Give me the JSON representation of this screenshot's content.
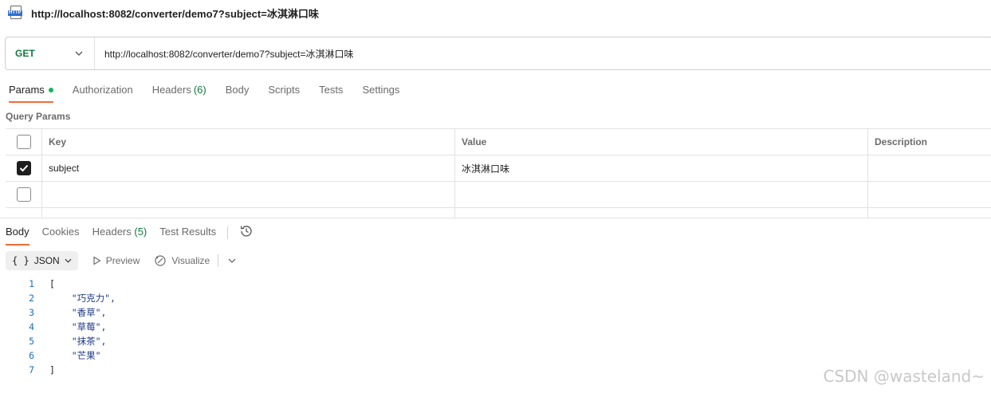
{
  "window": {
    "icon": "http-file-icon",
    "icon_label": "HTTP",
    "title": "http://localhost:8082/converter/demo7?subject=冰淇淋口味"
  },
  "request": {
    "method": "GET",
    "url": "http://localhost:8082/converter/demo7?subject=冰淇淋口味"
  },
  "request_tabs": [
    {
      "label": "Params",
      "active": true,
      "dot": true
    },
    {
      "label": "Authorization"
    },
    {
      "label": "Headers",
      "count": "(6)"
    },
    {
      "label": "Body"
    },
    {
      "label": "Scripts"
    },
    {
      "label": "Tests"
    },
    {
      "label": "Settings"
    }
  ],
  "query_params": {
    "label": "Query Params",
    "headers": {
      "key": "Key",
      "value": "Value",
      "description": "Description"
    },
    "rows": [
      {
        "checked": true,
        "key": "subject",
        "value": "冰淇淋口味",
        "description": ""
      },
      {
        "checked": false,
        "key": "",
        "value": "",
        "description": ""
      }
    ]
  },
  "response_tabs": [
    {
      "label": "Body",
      "active": true
    },
    {
      "label": "Cookies"
    },
    {
      "label": "Headers",
      "count": "(5)"
    },
    {
      "label": "Test Results"
    }
  ],
  "response_toolbar": {
    "format": "JSON",
    "preview": "Preview",
    "visualize": "Visualize"
  },
  "response_body": {
    "lines": [
      {
        "n": "1",
        "text": "["
      },
      {
        "n": "2",
        "text": "    \"巧克力\","
      },
      {
        "n": "3",
        "text": "    \"香草\","
      },
      {
        "n": "4",
        "text": "    \"草莓\","
      },
      {
        "n": "5",
        "text": "    \"抹茶\","
      },
      {
        "n": "6",
        "text": "    \"芒果\""
      },
      {
        "n": "7",
        "text": "]"
      }
    ]
  },
  "watermark": "CSDN @wasteland~",
  "colors": {
    "method_get": "#0d7a3e",
    "tab_accent": "#f26b3a",
    "status_dot": "#0cbb52"
  }
}
